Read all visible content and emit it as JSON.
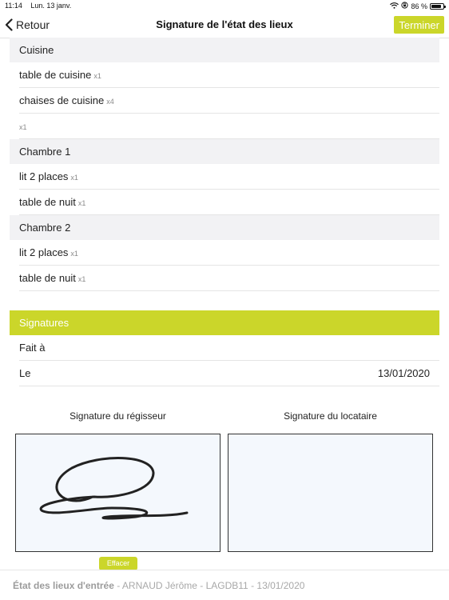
{
  "status_bar": {
    "time": "11:14",
    "date": "Lun. 13 janv.",
    "battery_text": "86 %",
    "battery_level": 0.86
  },
  "nav": {
    "back_label": "Retour",
    "title": "Signature de l'état des lieux",
    "finish_label": "Terminer"
  },
  "rooms": [
    {
      "name": "Cuisine",
      "items": [
        {
          "label": "table de cuisine",
          "qty": "x1"
        },
        {
          "label": "chaises de cuisine",
          "qty": "x4"
        },
        {
          "label": "",
          "qty": "x1"
        }
      ]
    },
    {
      "name": "Chambre 1",
      "items": [
        {
          "label": "lit 2 places",
          "qty": "x1"
        },
        {
          "label": "table de nuit",
          "qty": "x1"
        }
      ]
    },
    {
      "name": "Chambre 2",
      "items": [
        {
          "label": "lit 2 places",
          "qty": "x1"
        },
        {
          "label": "table de nuit",
          "qty": "x1"
        }
      ]
    }
  ],
  "signatures": {
    "header": "Signatures",
    "made_at_label": "Fait à",
    "made_at_value": "",
    "date_label": "Le",
    "date_value": "13/01/2020",
    "manager_label": "Signature du régisseur",
    "tenant_label": "Signature du locataire",
    "clear_label": "Effacer"
  },
  "footer": {
    "title": "État des lieux d'entrée",
    "details": " - ARNAUD Jérôme - LAGDB11 - 13/01/2020"
  },
  "colors": {
    "accent": "#cbd62a",
    "section_bg": "#f2f2f4",
    "pad_bg": "#f4f8fd"
  }
}
